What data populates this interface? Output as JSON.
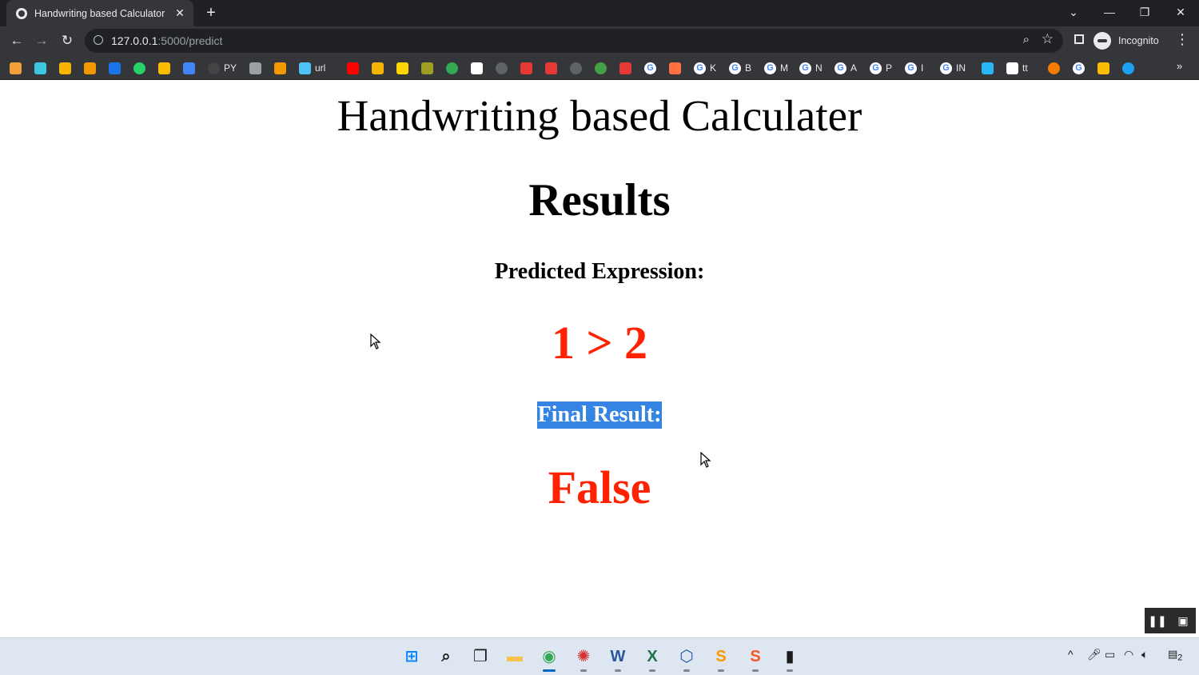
{
  "browser": {
    "tab_title": "Handwriting based Calculator",
    "url_host": "127.0.0.1",
    "url_path": ":5000/predict",
    "profile_label": "Incognito",
    "bookmarks": [
      {
        "icon": "flag-icon",
        "color": "#f4a03a",
        "label": ""
      },
      {
        "icon": "swirl-icon",
        "color": "#3ec6e0",
        "label": ""
      },
      {
        "icon": "badge-icon",
        "color": "#f7b500",
        "label": ""
      },
      {
        "icon": "bar-chart-icon",
        "color": "#f29900",
        "label": ""
      },
      {
        "icon": "grid-icon",
        "color": "#1a73e8",
        "label": ""
      },
      {
        "icon": "chat-icon",
        "color": "#25d366",
        "label": ""
      },
      {
        "icon": "ads-icon",
        "color": "#fbbc04",
        "label": ""
      },
      {
        "icon": "drive-icon",
        "color": "#4285f4",
        "label": ""
      },
      {
        "icon": "github-icon",
        "color": "#444444",
        "label": "PY"
      },
      {
        "icon": "store-icon",
        "color": "#9aa0a6",
        "label": ""
      },
      {
        "icon": "arch-icon",
        "color": "#f29900",
        "label": ""
      },
      {
        "icon": "link-icon",
        "color": "#4fc3f7",
        "label": "url"
      },
      {
        "icon": "youtube-icon",
        "color": "#ff0000",
        "label": ""
      },
      {
        "icon": "tag-icon",
        "color": "#f4b400",
        "label": ""
      },
      {
        "icon": "p-icon",
        "color": "#ffd600",
        "label": ""
      },
      {
        "icon": "mask-icon",
        "color": "#9e9d24",
        "label": ""
      },
      {
        "icon": "ring-icon",
        "color": "#34a853",
        "label": ""
      },
      {
        "icon": "note-icon",
        "color": "#ffffff",
        "label": ""
      },
      {
        "icon": "globe-icon",
        "color": "#5f6368",
        "label": ""
      },
      {
        "icon": "heart-icon",
        "color": "#e53935",
        "label": ""
      },
      {
        "icon": "card-icon",
        "color": "#e53935",
        "label": ""
      },
      {
        "icon": "globe-icon",
        "color": "#5f6368",
        "label": ""
      },
      {
        "icon": "leaf-icon",
        "color": "#43a047",
        "label": ""
      },
      {
        "icon": "card-icon",
        "color": "#e53935",
        "label": ""
      },
      {
        "icon": "google-icon",
        "color": "#ffffff",
        "label": ""
      },
      {
        "icon": "bolt-icon",
        "color": "#ff7043",
        "label": ""
      },
      {
        "icon": "google-icon",
        "color": "#ffffff",
        "label": "K"
      },
      {
        "icon": "google-icon",
        "color": "#ffffff",
        "label": "B"
      },
      {
        "icon": "google-icon",
        "color": "#ffffff",
        "label": "M"
      },
      {
        "icon": "google-icon",
        "color": "#ffffff",
        "label": "N"
      },
      {
        "icon": "google-icon",
        "color": "#ffffff",
        "label": "A"
      },
      {
        "icon": "google-icon",
        "color": "#ffffff",
        "label": "P"
      },
      {
        "icon": "google-icon",
        "color": "#ffffff",
        "label": "I"
      },
      {
        "icon": "google-icon",
        "color": "#ffffff",
        "label": "IN"
      },
      {
        "icon": "azure-icon",
        "color": "#29b6f6",
        "label": ""
      },
      {
        "icon": "monitor-icon",
        "color": "#ffffff",
        "label": "tt"
      },
      {
        "icon": "sun-icon",
        "color": "#f57c00",
        "label": ""
      },
      {
        "icon": "google-icon",
        "color": "#ffffff",
        "label": ""
      },
      {
        "icon": "pinwheel-icon",
        "color": "#fbbc04",
        "label": ""
      },
      {
        "icon": "hand-icon",
        "color": "#1da1f2",
        "label": ""
      }
    ]
  },
  "page": {
    "heading": "Handwriting based Calculater",
    "results_heading": "Results",
    "predicted_label": "Predicted Expression:",
    "expression": "1 > 2",
    "final_label": "Final Result:",
    "final_value": "False",
    "result_color": "#ff2200"
  },
  "taskbar": {
    "apps": [
      {
        "name": "start-icon",
        "active": false
      },
      {
        "name": "search-icon",
        "active": false
      },
      {
        "name": "task-view-icon",
        "active": false
      },
      {
        "name": "file-explorer-icon",
        "active": false
      },
      {
        "name": "chrome-icon",
        "active": true
      },
      {
        "name": "davinci-icon",
        "active": false
      },
      {
        "name": "word-icon",
        "active": false
      },
      {
        "name": "excel-icon",
        "active": false
      },
      {
        "name": "virtualbox-icon",
        "active": false
      },
      {
        "name": "sublime-icon",
        "active": false
      },
      {
        "name": "sourcetree-icon",
        "active": false
      },
      {
        "name": "terminal-icon",
        "active": false
      }
    ],
    "notification_count": "2"
  }
}
